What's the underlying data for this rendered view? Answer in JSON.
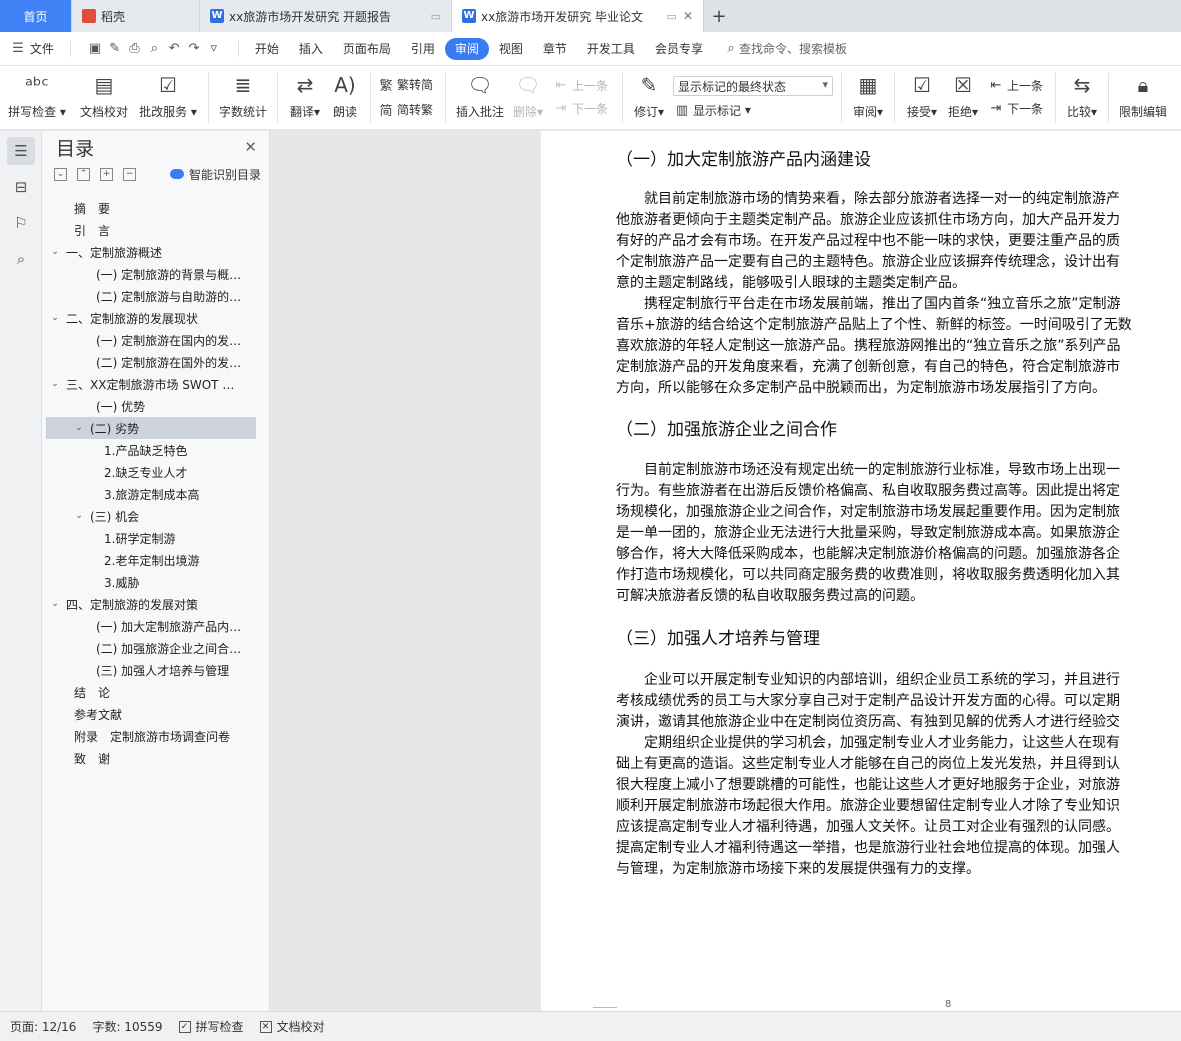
{
  "tabs": {
    "home": "首页",
    "t1": "稻壳",
    "t2": "xx旅游市场开发研究 开题报告",
    "t3": "xx旅游市场开发研究 毕业论文",
    "new": "+"
  },
  "menu": {
    "file": "文件",
    "items": [
      "开始",
      "插入",
      "页面布局",
      "引用",
      "审阅",
      "视图",
      "章节",
      "开发工具",
      "会员专享"
    ],
    "active": "审阅",
    "search": "查找命令、搜索模板"
  },
  "ribbon": {
    "spell": "拼写检查",
    "doccheck": "文档校对",
    "revise_service": "批改服务",
    "wordcount": "字数统计",
    "translate": "翻译",
    "read": "朗读",
    "to_trad": "繁转简",
    "to_simp": "简转繁",
    "insert_comment": "插入批注",
    "delete": "删除",
    "prev_comment": "上一条",
    "next_comment": "下一条",
    "track": "修订",
    "markup_select": "显示标记的最终状态",
    "show_markup": "显示标记",
    "review": "审阅",
    "accept": "接受",
    "reject": "拒绝",
    "prev": "上一条",
    "next": "下一条",
    "compare": "比较",
    "restrict": "限制编辑"
  },
  "nav": {
    "title": "目录",
    "smart": "智能识别目录",
    "items": [
      {
        "text": "摘　要",
        "level": 0,
        "exp": ""
      },
      {
        "text": "引　言",
        "level": 0,
        "exp": ""
      },
      {
        "text": "一、定制旅游概述",
        "level": 0,
        "exp": "v"
      },
      {
        "text": "(一) 定制旅游的背景与概…",
        "level": 1,
        "exp": ""
      },
      {
        "text": "(二) 定制旅游与自助游的…",
        "level": 1,
        "exp": ""
      },
      {
        "text": "二、定制旅游的发展现状",
        "level": 0,
        "exp": "v"
      },
      {
        "text": "(一) 定制旅游在国内的发…",
        "level": 1,
        "exp": ""
      },
      {
        "text": "(二) 定制旅游在国外的发…",
        "level": 1,
        "exp": ""
      },
      {
        "text": "三、XX定制旅游市场 SWOT …",
        "level": 0,
        "exp": "v"
      },
      {
        "text": "(一) 优势",
        "level": 1,
        "exp": ""
      },
      {
        "text": "(二) 劣势",
        "level": 1,
        "exp": "v",
        "sel": true
      },
      {
        "text": "1.产品缺乏特色",
        "level": 2,
        "exp": ""
      },
      {
        "text": "2.缺乏专业人才",
        "level": 2,
        "exp": ""
      },
      {
        "text": "3.旅游定制成本高",
        "level": 2,
        "exp": ""
      },
      {
        "text": "(三) 机会",
        "level": 1,
        "exp": "v"
      },
      {
        "text": "1.研学定制游",
        "level": 2,
        "exp": ""
      },
      {
        "text": "2.老年定制出境游",
        "level": 2,
        "exp": ""
      },
      {
        "text": "3.威胁",
        "level": 2,
        "exp": ""
      },
      {
        "text": "四、定制旅游的发展对策",
        "level": 0,
        "exp": "v"
      },
      {
        "text": "(一) 加大定制旅游产品内…",
        "level": 1,
        "exp": ""
      },
      {
        "text": "(二) 加强旅游企业之间合…",
        "level": 1,
        "exp": ""
      },
      {
        "text": "(三) 加强人才培养与管理",
        "level": 1,
        "exp": ""
      },
      {
        "text": "结　论",
        "level": 0,
        "exp": ""
      },
      {
        "text": "参考文献",
        "level": 0,
        "exp": ""
      },
      {
        "text": "附录　定制旅游市场调查问卷",
        "level": 0,
        "exp": ""
      },
      {
        "text": "致　谢",
        "level": 0,
        "exp": ""
      }
    ]
  },
  "doc": {
    "h1": "（一）加大定制旅游产品内涵建设",
    "p1": [
      "　　就目前定制旅游市场的情势来看，除去部分旅游者选择一对一的纯定制旅游产",
      "他旅游者更倾向于主题类定制产品。旅游企业应该抓住市场方向，加大产品开发力",
      "有好的产品才会有市场。在开发产品过程中也不能一味的求快，更要注重产品的质",
      "个定制旅游产品一定要有自己的主题特色。旅游企业应该摒弃传统理念，设计出有",
      "意的主题定制路线，能够吸引人眼球的主题类定制产品。",
      "　　携程定制旅行平台走在市场发展前端，推出了国内首条“独立音乐之旅”定制游",
      "音乐+旅游的结合给这个定制旅游产品贴上了个性、新鲜的标签。一时间吸引了无数",
      "喜欢旅游的年轻人定制这一旅游产品。携程旅游网推出的“独立音乐之旅”系列产品",
      "定制旅游产品的开发角度来看，充满了创新创意，有自己的特色，符合定制旅游市",
      "方向，所以能够在众多定制产品中脱颖而出，为定制旅游市场发展指引了方向。"
    ],
    "h2": "（二）加强旅游企业之间合作",
    "p2": [
      "　　目前定制旅游市场还没有规定出统一的定制旅游行业标准，导致市场上出现一",
      "行为。有些旅游者在出游后反馈价格偏高、私自收取服务费过高等。因此提出将定",
      "场规模化，加强旅游企业之间合作，对定制旅游市场发展起重要作用。因为定制旅",
      "是一单一团的，旅游企业无法进行大批量采购，导致定制旅游成本高。如果旅游企",
      "够合作，将大大降低采购成本，也能解决定制旅游价格偏高的问题。加强旅游各企",
      "作打造市场规模化，可以共同商定服务费的收费准则，将收取服务费透明化加入其",
      "可解决旅游者反馈的私自收取服务费过高的问题。"
    ],
    "h3": "（三）加强人才培养与管理",
    "p3": [
      "　　企业可以开展定制专业知识的内部培训，组织企业员工系统的学习，并且进行",
      "考核成绩优秀的员工与大家分享自己对于定制产品设计开发方面的心得。可以定期",
      "演讲，邀请其他旅游企业中在定制岗位资历高、有独到见解的优秀人才进行经验交",
      "　　定期组织企业提供的学习机会，加强定制专业人才业务能力，让这些人在现有",
      "础上有更高的造诣。这些定制专业人才能够在自己的岗位上发光发热，并且得到认",
      "很大程度上减小了想要跳槽的可能性，也能让这些人才更好地服务于企业，对旅游",
      "顺利开展定制旅游市场起很大作用。旅游企业要想留住定制专业人才除了专业知识",
      "应该提高定制专业人才福利待遇，加强人文关怀。让员工对企业有强烈的认同感。",
      "提高定制专业人才福利待遇这一举措，也是旅游行业社会地位提高的体现。加强人",
      "与管理，为定制旅游市场接下来的发展提供强有力的支撑。"
    ],
    "page_number": "8"
  },
  "status": {
    "page": "页面: 12/16",
    "words": "字数: 10559",
    "spell": "拼写检查",
    "doccheck": "文档校对"
  }
}
